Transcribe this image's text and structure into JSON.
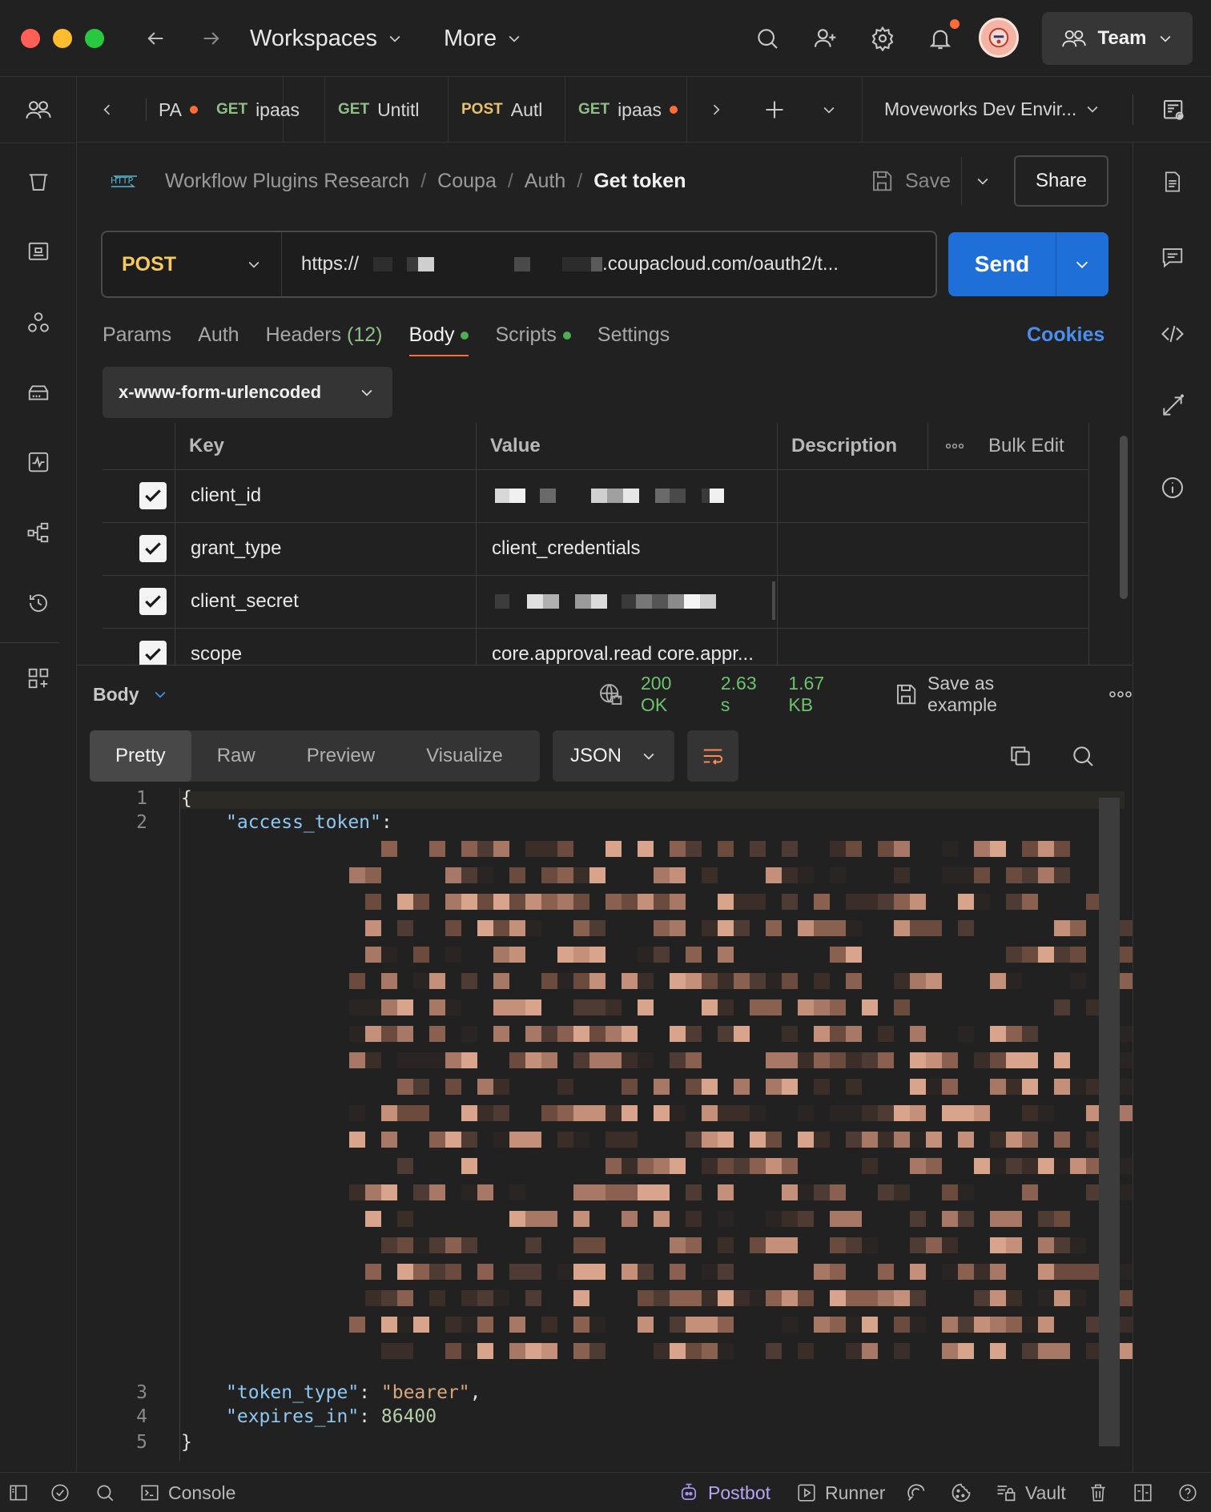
{
  "topbar": {
    "workspaces_label": "Workspaces",
    "more_label": "More",
    "team_label": "Team"
  },
  "tabs": [
    {
      "method": "",
      "name": "PA",
      "unsaved": true
    },
    {
      "method": "GET",
      "name": "ipaas",
      "unsaved": false
    },
    {
      "method": "GET",
      "name": "Untitl",
      "unsaved": false
    },
    {
      "method": "POST",
      "name": "Autl",
      "unsaved": false
    },
    {
      "method": "GET",
      "name": "ipaas",
      "unsaved": true
    }
  ],
  "environment": "Moveworks Dev Envir...",
  "breadcrumb": {
    "icon_text": "HTTP",
    "items": [
      "Workflow Plugins Research",
      "Coupa",
      "Auth"
    ],
    "separator": "/",
    "current": "Get token"
  },
  "toolbar": {
    "save_label": "Save",
    "share_label": "Share"
  },
  "request": {
    "method": "POST",
    "url_prefix": "https://",
    "url_suffix": ".coupacloud.com/oauth2/t...",
    "send_label": "Send"
  },
  "request_tabs": {
    "params": "Params",
    "auth": "Auth",
    "headers": "Headers",
    "headers_count": "(12)",
    "body": "Body",
    "scripts": "Scripts",
    "settings": "Settings",
    "cookies": "Cookies"
  },
  "body_type": "x-www-form-urlencoded",
  "params_table": {
    "headers": {
      "key": "Key",
      "value": "Value",
      "description": "Description",
      "bulk_edit": "Bulk Edit"
    },
    "rows": [
      {
        "key": "client_id",
        "value": "",
        "checked": true
      },
      {
        "key": "grant_type",
        "value": "client_credentials",
        "checked": true
      },
      {
        "key": "client_secret",
        "value": "",
        "checked": true
      },
      {
        "key": "scope",
        "value": "core.approval.read core.appr...",
        "checked": true
      }
    ]
  },
  "response": {
    "body_label": "Body",
    "status": "200 OK",
    "time": "2.63 s",
    "size": "1.67 KB",
    "save_example_label": "Save as example",
    "view_tabs": [
      "Pretty",
      "Raw",
      "Preview",
      "Visualize"
    ],
    "format": "JSON",
    "lines": [
      {
        "num": "1",
        "text": "{"
      },
      {
        "num": "2",
        "key": "\"access_token\"",
        "after": ":"
      },
      {
        "num": "3",
        "key": "\"token_type\"",
        "after": ": ",
        "value": "\"bearer\"",
        "tail": ","
      },
      {
        "num": "4",
        "key": "\"expires_in\"",
        "after": ": ",
        "value": "86400"
      },
      {
        "num": "5",
        "text": "}"
      }
    ]
  },
  "statusbar": {
    "console": "Console",
    "postbot": "Postbot",
    "runner": "Runner",
    "vault": "Vault"
  },
  "colors": {
    "accent": "#ff6c37",
    "send": "#1f6fd9",
    "status_ok": "#6cc36c",
    "method_post": "#f4c95d",
    "method_get": "#8fbf86"
  }
}
